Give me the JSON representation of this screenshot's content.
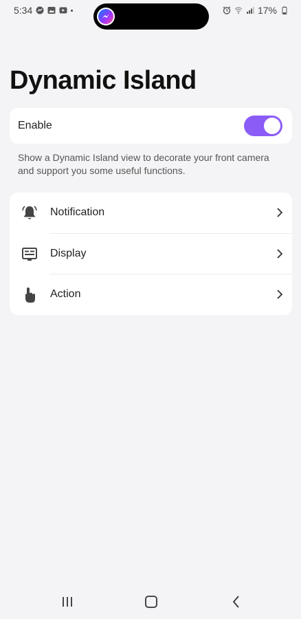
{
  "status_bar": {
    "time": "5:34",
    "battery": "17%",
    "left_icons": [
      "messenger-icon",
      "gallery-icon",
      "youtube-icon"
    ],
    "right_icons": [
      "alarm-icon",
      "wifi-icon",
      "signal-icon",
      "battery-icon"
    ]
  },
  "page": {
    "title": "Dynamic Island"
  },
  "enable": {
    "label": "Enable",
    "on": true,
    "accent_color": "#8b5cf6"
  },
  "description": "Show a Dynamic Island view to decorate your front camera and support you some useful functions.",
  "menu": {
    "items": [
      {
        "label": "Notification",
        "icon": "bell-icon"
      },
      {
        "label": "Display",
        "icon": "display-icon"
      },
      {
        "label": "Action",
        "icon": "hand-pointer-icon"
      }
    ]
  },
  "nav": {
    "buttons": [
      "recents-icon",
      "home-icon",
      "back-icon"
    ]
  }
}
